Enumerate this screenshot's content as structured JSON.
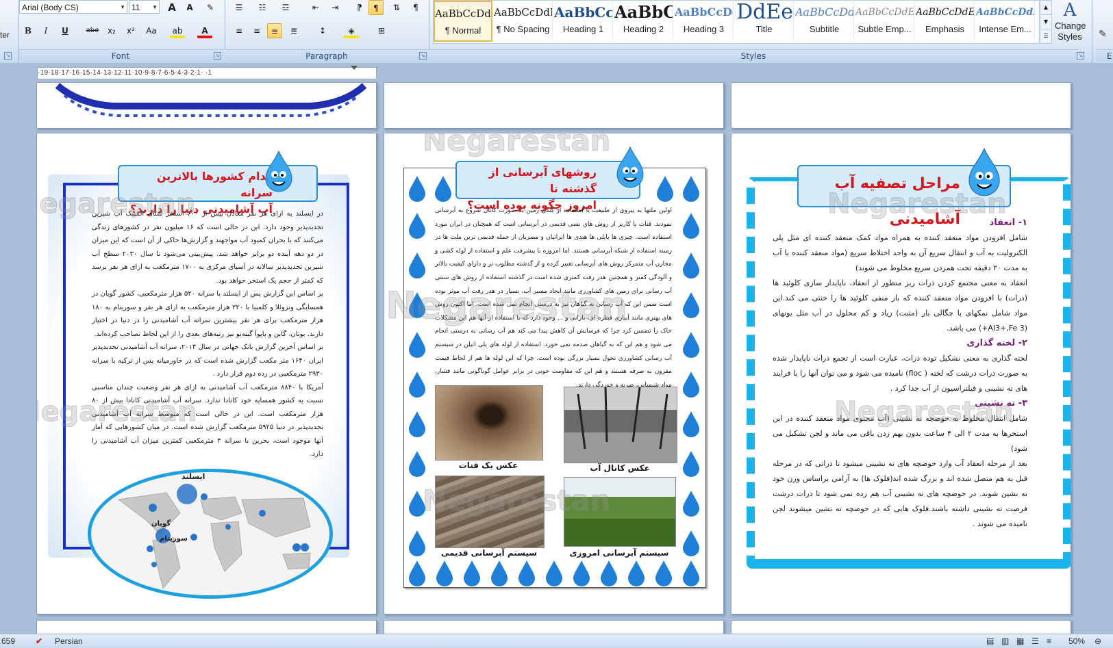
{
  "ribbon": {
    "font": {
      "name": "Arial (Body CS)",
      "size": "11",
      "group_label": "Font",
      "buttons": {
        "grow": "A",
        "shrink": "A",
        "clear": "✎",
        "bold": "B",
        "italic": "I",
        "underline": "U",
        "strike": "abe",
        "subscript": "x₂",
        "superscript": "x²",
        "case": "Aa",
        "highlight": "ab",
        "color": "A"
      }
    },
    "paragraph": {
      "group_label": "Paragraph"
    },
    "styles": {
      "group_label": "Styles",
      "change_styles": "Change Styles",
      "gallery": [
        {
          "sample": "AaBbCcDdEe",
          "name": "¶ Normal"
        },
        {
          "sample": "AaBbCcDdEe",
          "name": "¶ No Spacing"
        },
        {
          "sample": "AaBbCcDdEe",
          "name": "Heading 1"
        },
        {
          "sample": "AaBbCcDdEe",
          "name": "Heading 2"
        },
        {
          "sample": "AaBbCcDdEe",
          "name": "Heading 3"
        },
        {
          "sample": "AaBbCcDdEe",
          "name": "Title"
        },
        {
          "sample": "AaBbCcDdEe",
          "name": "Subtitle"
        },
        {
          "sample": "AaBbCcDdEe",
          "name": "Subtle Emp..."
        },
        {
          "sample": "AaBbCcDdEe",
          "name": "Emphasis"
        },
        {
          "sample": "AaBbCcDdEe",
          "name": "Intense Em..."
        }
      ]
    },
    "left_cut_label": "ter",
    "right_cut_label": "E"
  },
  "ruler": {
    "text": "·19·18·17·16·15·14·13·12·11·10·9·8·7·6·5·4·3·2·1·  ·1"
  },
  "watermark": "Negarestan",
  "pages": {
    "left": {
      "title_line1": "کدام کشورها بالاترین سرانه",
      "title_line2": "آب آشامیدنی دنیا را دارند؟",
      "paragraphs": [
        "در ایسلند به ازای هر نفر معادل بیش از ۶۰۰ استخر شنای المپیک آب شیرین تجدیدپذیر وجود دارد. این در حالی است که ۱۶ میلیون نفر در کشورهای زندگی می‌کنند که با بحران کمبود آب مواجهند و گزارش‌ها حاکی از آن است که این میزان در دو دهه آینده دو برابر خواهد شد. پیش‌بینی می‌شود تا سال ۲۰۳۰ سطح آب شیرین تجدیدپذیر سالانه در آسیای مرکزی به ۱۷۰۰ مترمکعب به ازای هر نفر برسد که کمتر از حجم یک استخر خواهد بود.",
        "بر اساس این گزارش پس از ایسلند با سرانه ۵۲۰ هزار مترمکعبی، کشور گویان در همسایگی ونزوئلا و کلمبیا با ۳۲۰ هزار مترمکعب به ازای هر نفر و سورینام به ۱۸۰ هزار مترمکعب برای هر نفر بیشترین سرانه آب آشامیدنی را در دنیا در اختیار دارند. بوتان، گابن و پاپوآ گینه‌نو نیز رتبه‌های بعدی را از این لحاظ تصاحب کرده‌اند.",
        "بر اساس آخرین گزارش بانک جهانی در سال ۲۰۱۴، سرانه آب آشامیدنی تجدیدپذیر ایران ۱۶۴۰ متر مکعب گزارش شده است که در خاورمیانه پس از ترکیه با سرانه ۲۹۳۰ مترمکعبی در رده دوم قرار دارد .",
        "آمریکا با ۸۸۴۰ مترمکعب آب آشامیدنی به ازای هر نفر وضعیت چندان مناسبی نسبت به کشور همسایه خود کانادا ندارد. سرانه آب آشامیدنی کانادا بیش از ۸۰ هزار مترمکعب است. این در حالی است که متوسط سرانه آب آشامیدنی تجدیدپذیر در دنیا ۵۹۲۵ مترمکعب گزارش شده است. در میان کشورهایی که آمار آنها موجود است، بحرین با سرانه ۳ مترمکعبی کمترین میزان آب آشامیدنی را دارد."
      ],
      "map_labels": {
        "iceland": "ایسلند",
        "guyana": "گویان",
        "suriname": "سورینام"
      }
    },
    "middle": {
      "title_line1": "روشهای آبرسانی از گذشته تا",
      "title_line2": "امروز چگونه بوده است؟",
      "paragraph": "اولین ملتها به پیروی از طبیعت یا استفاده از کندن زمین به صورت کانال شروع به آبرسانی نمودند. قنات یا کاریز از روش های بسی قدیمی در آبرسانی است که همچنان در ایران مورد استفاده است. چیزی ها یابلی ها هندی ها ایرانیان و مصریان از جمله قدیمی ترین ملت ها در زمینه استفاده از شبکه آبرسانی هستند. اما امروزه با پیشرفت علم و استفاده از لوله کشی و مخازن آب متمرکز روش های آبرسانی تغییر کرده و از گذشته مطلوب تر و دارای کیفیت بالاتر و آلودگی کمتر و همچنین هدر رفت کمتری شده است.در گذشته استفاده از روش های سنتی آب رسانی برای زمین های کشاورزی مانند ایجاد مسیر آب، بسیار در هدر رفت آب موثر بوده است ضمن این که آب رسانی به گیاهان نیز به درستی انجام نمی شده است. اما اکنون روش های بهتری مانند آبیاری قطره ای، بارانی و ... وجود دارد که با استفاده از آنها هم این مشکلات خاک را تضمین کرد چرا که فرسایش آن کاهش پیدا می کند هم آب رسانی به درستی انجام می شود و هم این که به گیاهان صدمه نمی خورد. استفاده از لوله های پلی اتیلن در سیستم آب رسانی کشاورزی تحول بسیار بزرگی بوده است. چرا که این لوله ها هم از لحاظ قیمت مقرون به صرفه هستند و هم این که مقاومت خوبی در برابر عوامل گوناگونی مانند فشار، مواد شیمیایی، ضربه و خوردگی دارند.",
      "captions": {
        "qanat": "عکس یک قنات",
        "canal": "عکس کانال آب",
        "old_system": "سیستم آبرسانی قدیمی",
        "new_system": "سیستم آبرسانی امروزی"
      }
    },
    "right": {
      "title": "مراحل تصفیه آب آشامیدنی",
      "h1": "۱- انعقاد",
      "p1": "شامل افزودن مواد منعقد کننده به همراه مواد کمک منعقد کننده ای مثل پلی الکترولیت به آب و انتقال سریع آن به واحد اختلاط سریع (مواد منعقد کننده با آب به مدت ۲۰ دقیقه تحت همزدن سریع مخلوط می شوند)",
      "p1b": "انعقاد به معنی مجتمع کردن ذرات ریز منظور از انعقاد، ناپایدار سازی کلوئید ها (ذرات) با افزودن مواد منعقد کننده که بار منفی کلوئید ها را خنثی می کند.این مواد شامل نمکهای با چگالی بار (مثبت) زیاد و کم محلول در آب مثل یونهای (Al3+,Fe 3+) می باشد.",
      "h2": "۲- لخته گذاری",
      "p2": "لخته گذاری به معنی تشکیل توده ذرات، عبارت است از تجمع ذرات ناپایدار شده به صورت ذرات درشت که لخته ( floc) نامیده می شود و می توان آنها را با فرایند های ته نشینی و فیلتراسیون از آب جدا کرد .",
      "h3": "۳- ته نشینی",
      "p3": "شامل انتقال مخلوط به حوضچه ته نشینی (آب محتوی مواد منعقد کننده در این استخرها به مدت ۲ الی ۴ ساعت بدون بهم زدن باقی می ماند و لجن تشکیل می شود)",
      "p3b": "بعد از مرحله انعقاد آب وارد حوضچه های ته نشینی میشود تا ذراتی که در مرحله قبل به هم متصل شده اند و بزرگ شده اند(فلوک ها) به آرامی براساس وزن خود ته نشین شوند. در حوضچه های ته نشینی آب هم زده نمی شود تا ذرات درشت فرصت ته نشینی داشته باشند.فلوک هایی که در حوضچه ته نشین میشوند لجن نامیده می شوند ."
    }
  },
  "status": {
    "page": "659",
    "language": "Persian",
    "zoom": "50%"
  },
  "colors": {
    "title_red": "#d4151b",
    "drop_blue": "#1f7fd8",
    "frame_blue": "#1a2ec8",
    "section_purple": "#7a1c7a"
  }
}
